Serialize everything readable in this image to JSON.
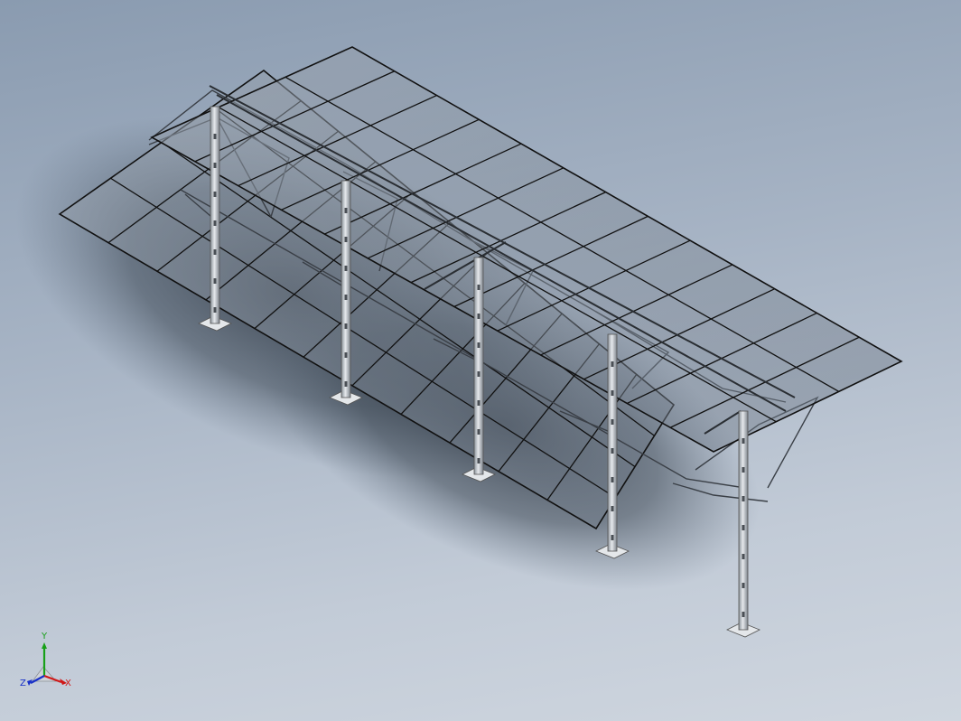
{
  "viewport": {
    "background_top": "#8a9bb0",
    "background_bottom": "#cfd6df",
    "model": "solar-panel-carport-structure"
  },
  "triad": {
    "x_label": "X",
    "y_label": "Y",
    "z_label": "Z",
    "x_color": "#d01818",
    "y_color": "#18a018",
    "z_color": "#1830c8"
  }
}
